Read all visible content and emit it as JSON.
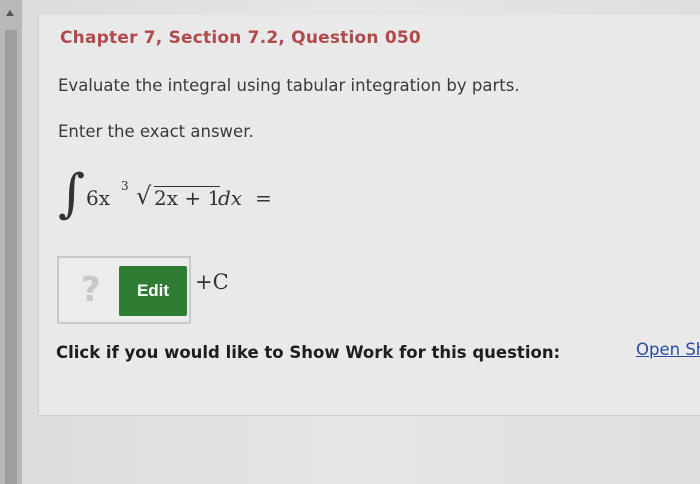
{
  "question": {
    "title": "Chapter 7, Section 7.2, Question 050",
    "instruction": "Evaluate the integral using tabular integration by parts.",
    "answer_hint": "Enter the exact answer."
  },
  "math": {
    "integral_sign": "∫",
    "coefficient": "6x",
    "exponent": "3",
    "sqrt_symbol": "√",
    "radicand": "2x + 1",
    "differential": "dx",
    "equals": "="
  },
  "answer": {
    "placeholder_glyph": "?",
    "edit_label": "Edit",
    "constant": "+C"
  },
  "show_work": {
    "prompt": "Click if you would like to Show Work for this question:",
    "link_text": "Open Show Work"
  },
  "colors": {
    "title": "#b14a4a",
    "edit_button": "#2f7d32",
    "link": "#2b4d9e"
  }
}
